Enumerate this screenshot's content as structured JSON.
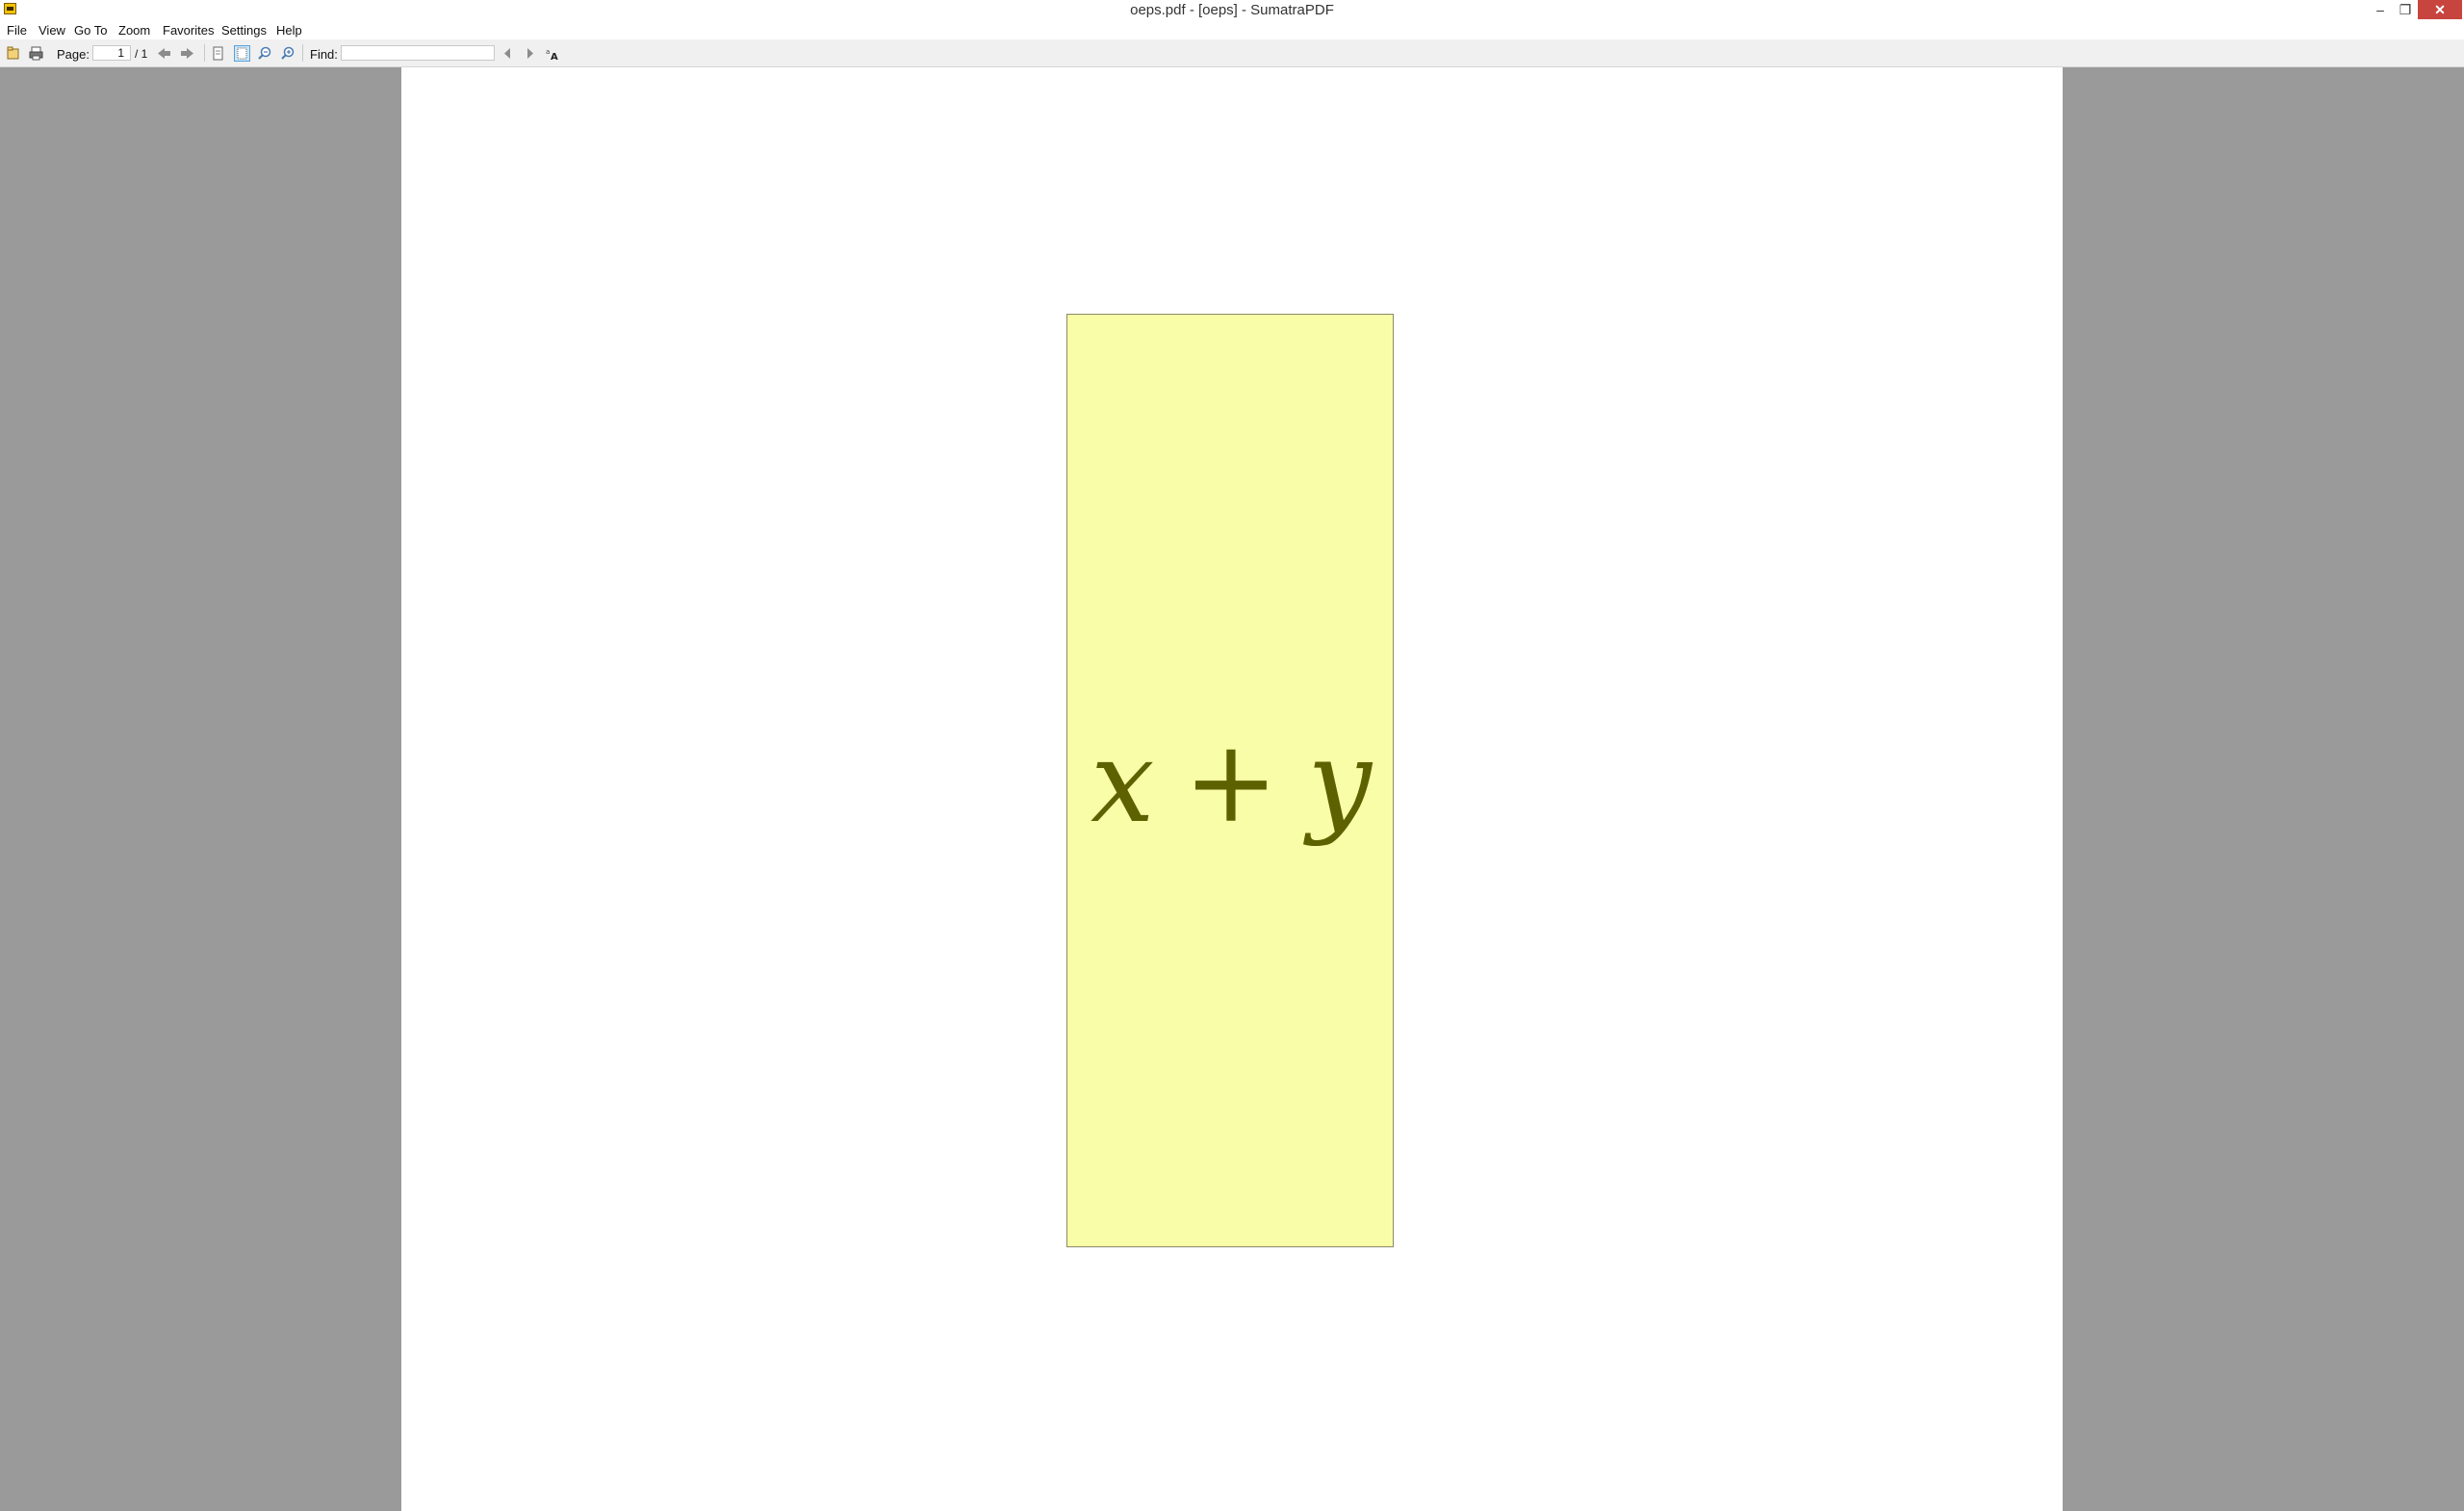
{
  "window": {
    "title": "oeps.pdf - [oeps] - SumatraPDF",
    "minimize_glyph": "–",
    "restore_glyph": "❐",
    "close_glyph": "✕"
  },
  "menu": {
    "items": [
      "File",
      "View",
      "Go To",
      "Zoom",
      "Favorites",
      "Settings",
      "Help"
    ]
  },
  "toolbar": {
    "page_label": "Page:",
    "page_value": "1",
    "page_total": "/ 1",
    "find_label": "Find:",
    "find_value": "",
    "icons": [
      "open-icon",
      "print-icon",
      "prev-page-icon",
      "next-page-icon",
      "fit-page-icon",
      "fit-width-icon",
      "zoom-out-icon",
      "zoom-in-icon",
      "find-prev-icon",
      "find-next-icon",
      "match-case-icon"
    ]
  },
  "document": {
    "formula": {
      "var1": "x",
      "op": "+",
      "var2": "y"
    },
    "box_color": "#fafda7",
    "text_color": "#5e6100"
  }
}
